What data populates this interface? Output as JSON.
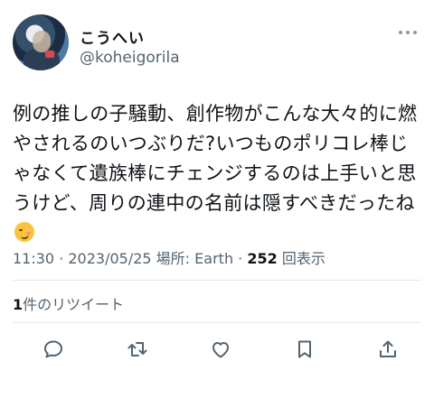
{
  "user": {
    "display_name": "こうへい",
    "handle": "@koheigorila"
  },
  "tweet": {
    "text": "例の推しの子騒動、創作物がこんな大々的に燃やされるのいつぶりだ?いつものポリコレ棒じゃなくて遺族棒にチェンジするのは上手いと思うけど、周りの連中の名前は隠すべきだったね",
    "emoji": "face-with-uneven-eyes-and-wavy-mouth"
  },
  "meta": {
    "time": "11:30",
    "sep1": " · ",
    "date": "2023/05/25",
    "location_label": " 場所: ",
    "location": "Earth",
    "sep2": " · ",
    "views_count": "252",
    "views_label": " 回表示"
  },
  "engagement": {
    "retweet_count": "1",
    "retweet_label": "件のリツイート"
  },
  "icons": [
    "more-icon",
    "reply-icon",
    "retweet-icon",
    "like-icon",
    "bookmark-icon",
    "share-icon"
  ],
  "colors": {
    "text": "#0f1419",
    "secondary": "#536471",
    "divider": "#e6e9eb"
  }
}
